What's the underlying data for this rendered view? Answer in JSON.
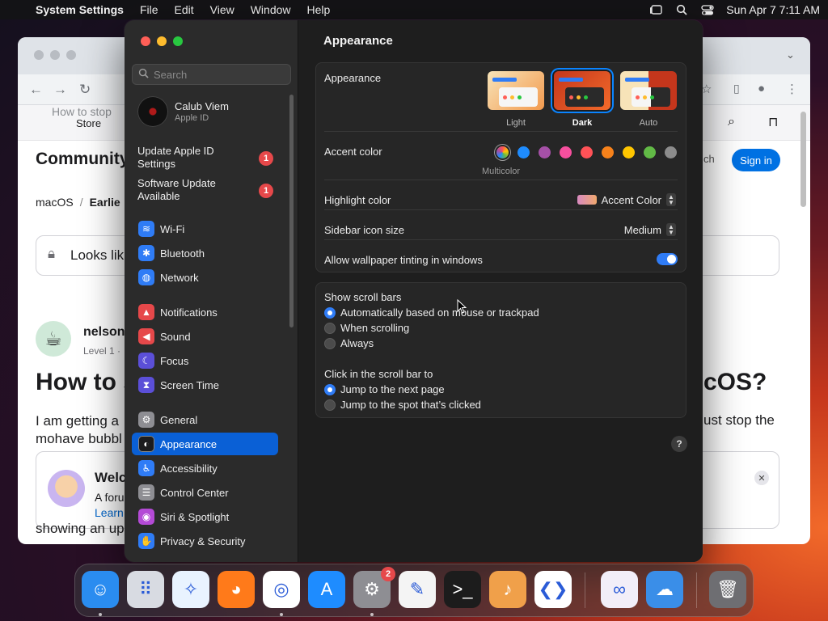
{
  "menubar": {
    "app_name": "System Settings",
    "menus": [
      "File",
      "Edit",
      "View",
      "Window",
      "Help"
    ],
    "datetime": "Sun Apr 7  7:11 AM"
  },
  "browser": {
    "ghost_tab": "How to stop",
    "nav_store": "Store",
    "community": "Community",
    "search_label": "ch",
    "signin": "Sign in",
    "breadcrumb": [
      "macOS",
      "Earlie"
    ],
    "banner_text": "Looks lik",
    "username": "nelson",
    "level": "Level 1  ·",
    "title_left": "How to s",
    "title_right": "cOS?",
    "body_left_1": "I am getting a",
    "body_left_2": "mohave bubbl",
    "body_right": "ust stop the",
    "welcome_title": "Welc",
    "welcome_sub": "A foru",
    "welcome_link": "Learn",
    "tail_text": "showing an up"
  },
  "sidebar": {
    "search_placeholder": "Search",
    "profile": {
      "name": "Calub Viem",
      "sub": "Apple ID"
    },
    "notices": [
      {
        "label_1": "Update Apple ID",
        "label_2": "Settings",
        "badge": "1"
      },
      {
        "label_1": "Software Update",
        "label_2": "Available",
        "badge": "1"
      }
    ],
    "items": [
      {
        "label": "Wi-Fi",
        "icon": "wifi-icon",
        "color": "#2f7cf6",
        "glyph": "≋"
      },
      {
        "label": "Bluetooth",
        "icon": "bluetooth-icon",
        "color": "#2f7cf6",
        "glyph": "✱"
      },
      {
        "label": "Network",
        "icon": "globe-icon",
        "color": "#2f7cf6",
        "glyph": "◍"
      },
      {
        "label": "Notifications",
        "icon": "bell-icon",
        "color": "#e6484a",
        "glyph": "▲"
      },
      {
        "label": "Sound",
        "icon": "speaker-icon",
        "color": "#e6484a",
        "glyph": "◀"
      },
      {
        "label": "Focus",
        "icon": "moon-icon",
        "color": "#5b4fd8",
        "glyph": "☾"
      },
      {
        "label": "Screen Time",
        "icon": "hourglass-icon",
        "color": "#5b4fd8",
        "glyph": "⧗"
      },
      {
        "label": "General",
        "icon": "gear-icon",
        "color": "#8e8e93",
        "glyph": "⚙"
      },
      {
        "label": "Appearance",
        "icon": "appearance-icon",
        "color": "#1c1c1e",
        "glyph": "◐"
      },
      {
        "label": "Accessibility",
        "icon": "accessibility-icon",
        "color": "#2f7cf6",
        "glyph": "♿"
      },
      {
        "label": "Control Center",
        "icon": "control-center-icon",
        "color": "#8e8e93",
        "glyph": "☰"
      },
      {
        "label": "Siri & Spotlight",
        "icon": "siri-icon",
        "color": "#b44ad6",
        "glyph": "◉"
      },
      {
        "label": "Privacy & Security",
        "icon": "hand-icon",
        "color": "#2f7cf6",
        "glyph": "✋"
      }
    ],
    "selected": "Appearance"
  },
  "content": {
    "title": "Appearance",
    "appearance": {
      "label": "Appearance",
      "options": [
        "Light",
        "Dark",
        "Auto"
      ],
      "selected": "Dark"
    },
    "accent": {
      "label": "Accent color",
      "selected_name": "Multicolor",
      "colors": [
        "#1e8cff",
        "#a550a7",
        "#f74f9e",
        "#ff5257",
        "#f7821b",
        "#ffc600",
        "#62ba46",
        "#8c8c8c"
      ]
    },
    "highlight": {
      "label": "Highlight color",
      "value": "Accent Color"
    },
    "sidebar_icon_size": {
      "label": "Sidebar icon size",
      "value": "Medium"
    },
    "wallpaper_tinting": {
      "label": "Allow wallpaper tinting in windows",
      "on": true
    },
    "scroll_bars": {
      "label": "Show scroll bars",
      "options": [
        "Automatically based on mouse or trackpad",
        "When scrolling",
        "Always"
      ],
      "selected": 0
    },
    "click_scroll": {
      "label": "Click in the scroll bar to",
      "options": [
        "Jump to the next page",
        "Jump to the spot that’s clicked"
      ],
      "selected": 0
    },
    "help": "?"
  },
  "dock": {
    "apps": [
      {
        "name": "finder-icon",
        "color": "#2a8cf0",
        "glyph": "☺",
        "running": true
      },
      {
        "name": "launchpad-icon",
        "color": "#d8dbe2",
        "glyph": "⠿",
        "running": false
      },
      {
        "name": "safari-icon",
        "color": "#e9f3ff",
        "glyph": "✧",
        "running": false
      },
      {
        "name": "firefox-icon",
        "color": "#ff7a1a",
        "glyph": "◕",
        "running": false
      },
      {
        "name": "chrome-icon",
        "color": "#ffffff",
        "glyph": "◎",
        "running": true
      },
      {
        "name": "app-store-icon",
        "color": "#1e8cff",
        "glyph": "A",
        "running": false
      },
      {
        "name": "system-settings-icon",
        "color": "#8e8e93",
        "glyph": "⚙",
        "running": true,
        "badge": "2"
      },
      {
        "name": "textedit-icon",
        "color": "#f4f4f4",
        "glyph": "✎",
        "running": false
      },
      {
        "name": "terminal-icon",
        "color": "#1c1c1c",
        "glyph": ">_",
        "running": false
      },
      {
        "name": "garageband-icon",
        "color": "#f0a04a",
        "glyph": "♪",
        "running": false
      },
      {
        "name": "vscode-icon",
        "color": "#ffffff",
        "glyph": "❮❯",
        "running": false
      },
      {
        "name": "visual-studio-icon",
        "color": "#f2eef8",
        "glyph": "∞",
        "running": false
      },
      {
        "name": "weather-icon",
        "color": "#3a8ee8",
        "glyph": "☁",
        "running": false
      },
      {
        "name": "trash-icon",
        "color": "#6e6e72",
        "glyph": "🗑",
        "running": false
      }
    ]
  }
}
